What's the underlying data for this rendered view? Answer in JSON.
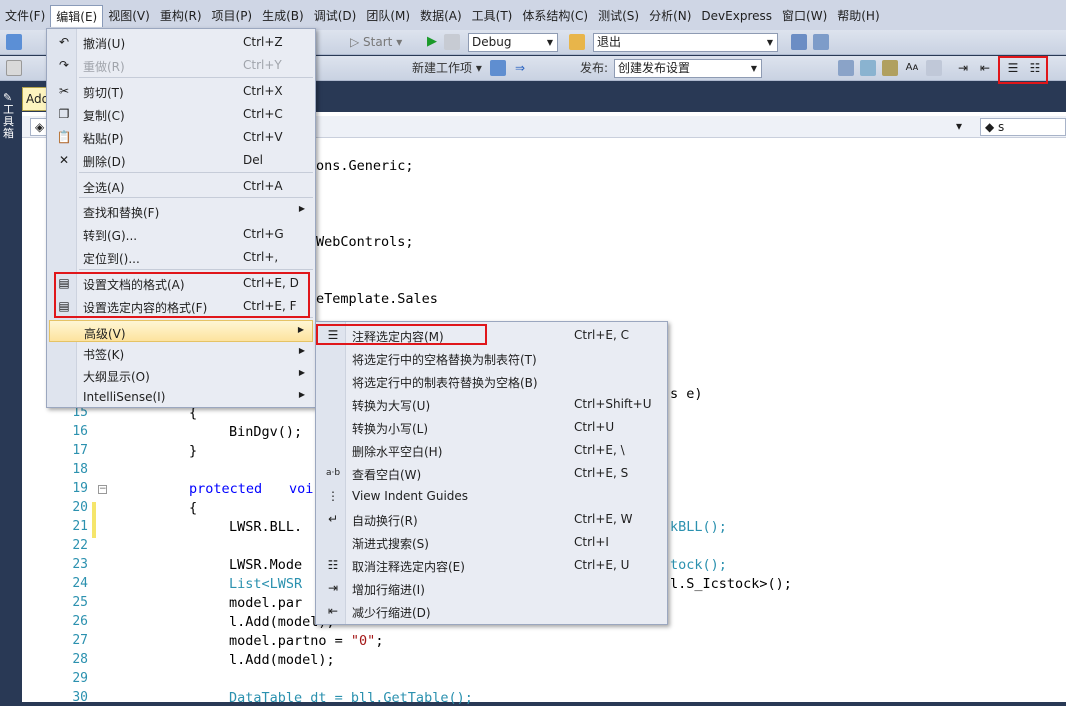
{
  "menubar": [
    "文件(F)",
    "编辑(E)",
    "视图(V)",
    "重构(R)",
    "项目(P)",
    "生成(B)",
    "调试(D)",
    "团队(M)",
    "数据(A)",
    "工具(T)",
    "体系结构(C)",
    "测试(S)",
    "分析(N)",
    "DevExpress",
    "窗口(W)",
    "帮助(H)"
  ],
  "toolbar1": {
    "start_label": "Start",
    "config": "Debug",
    "platform": "退出"
  },
  "toolbar2": {
    "new_workitem": "新建工作项",
    "publish_label": "发布:",
    "publish_value": "创建发布设置"
  },
  "doc_tab": "Add",
  "navbar": {
    "right_value": "s"
  },
  "edit_menu": [
    {
      "label": "撤消(U)",
      "shortcut": "Ctrl+Z",
      "icon": "undo-icon"
    },
    {
      "label": "重做(R)",
      "shortcut": "Ctrl+Y",
      "icon": "redo-icon",
      "disabled": true
    },
    {
      "label": "剪切(T)",
      "shortcut": "Ctrl+X",
      "icon": "cut-icon"
    },
    {
      "label": "复制(C)",
      "shortcut": "Ctrl+C",
      "icon": "copy-icon"
    },
    {
      "label": "粘贴(P)",
      "shortcut": "Ctrl+V",
      "icon": "paste-icon"
    },
    {
      "label": "删除(D)",
      "shortcut": "Del",
      "icon": "delete-icon"
    },
    {
      "label": "全选(A)",
      "shortcut": "Ctrl+A"
    },
    {
      "label": "查找和替换(F)",
      "shortcut": "",
      "submenu": true
    },
    {
      "label": "转到(G)...",
      "shortcut": "Ctrl+G"
    },
    {
      "label": "定位到()...",
      "shortcut": "Ctrl+,"
    },
    {
      "label": "设置文档的格式(A)",
      "shortcut": "Ctrl+E, D",
      "icon": "format-document-icon"
    },
    {
      "label": "设置选定内容的格式(F)",
      "shortcut": "Ctrl+E, F",
      "icon": "format-selection-icon"
    },
    {
      "label": "高级(V)",
      "shortcut": "",
      "submenu": true
    },
    {
      "label": "书签(K)",
      "shortcut": "",
      "submenu": true
    },
    {
      "label": "大纲显示(O)",
      "shortcut": "",
      "submenu": true
    },
    {
      "label": "IntelliSense(I)",
      "shortcut": "",
      "submenu": true
    }
  ],
  "advanced_menu": [
    {
      "label": "注释选定内容(M)",
      "shortcut": "Ctrl+E, C",
      "icon": "comment-icon"
    },
    {
      "label": "将选定行中的空格替换为制表符(T)",
      "shortcut": ""
    },
    {
      "label": "将选定行中的制表符替换为空格(B)",
      "shortcut": ""
    },
    {
      "label": "转换为大写(U)",
      "shortcut": "Ctrl+Shift+U"
    },
    {
      "label": "转换为小写(L)",
      "shortcut": "Ctrl+U"
    },
    {
      "label": "删除水平空白(H)",
      "shortcut": "Ctrl+E, \\"
    },
    {
      "label": "查看空白(W)",
      "shortcut": "Ctrl+E, S",
      "icon": "whitespace-icon"
    },
    {
      "label": "View Indent Guides",
      "shortcut": "",
      "icon": "indent-guides-icon"
    },
    {
      "label": "自动换行(R)",
      "shortcut": "Ctrl+E, W",
      "icon": "word-wrap-icon"
    },
    {
      "label": "渐进式搜索(S)",
      "shortcut": "Ctrl+I"
    },
    {
      "label": "取消注释选定内容(E)",
      "shortcut": "Ctrl+E, U",
      "icon": "uncomment-icon"
    },
    {
      "label": "增加行缩进(I)",
      "shortcut": "",
      "icon": "increase-indent-icon"
    },
    {
      "label": "减少行缩进(D)",
      "shortcut": "",
      "icon": "decrease-indent-icon"
    }
  ],
  "code_fragments": {
    "l1": "ons.Generic;",
    "l2": "WebControls;",
    "l3": "eTemplate.Sales",
    "l4": "s e)",
    "l16": "BinDgv();",
    "l19a": "protected",
    "l19b": "voi",
    "l21a": "LWSR.BLL.",
    "l21b": "kBLL();",
    "l23a": "LWSR.Mode",
    "l23b": "tock();",
    "l24a": "List<LWSR",
    "l24b": "l.S_Icstock>();",
    "l25": "model.par",
    "l26": "l.Add(model);",
    "l27a": "model.partno = ",
    "l27b": "\"0\"",
    "l27c": ";",
    "l28": "l.Add(model);",
    "l30": "DataTable dt = bll.GetTable();"
  },
  "line_numbers": [
    "15",
    "16",
    "17",
    "18",
    "19",
    "20",
    "21",
    "22",
    "23",
    "24",
    "25",
    "26",
    "27",
    "28",
    "29",
    "30"
  ]
}
